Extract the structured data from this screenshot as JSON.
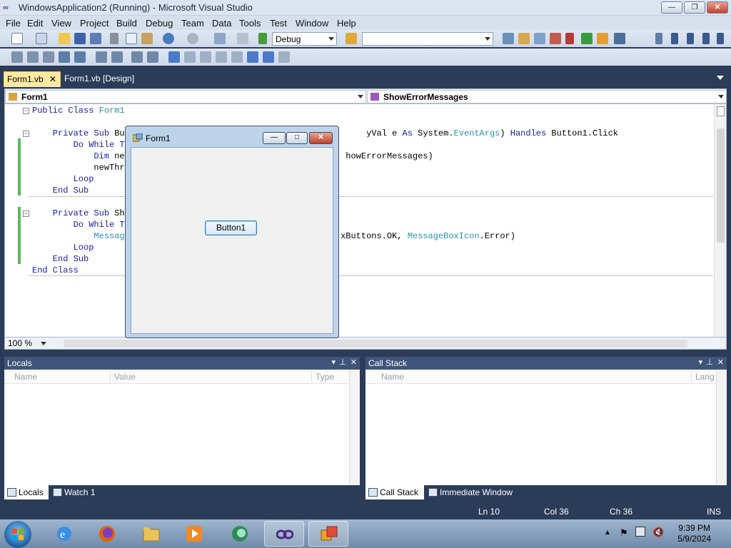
{
  "window": {
    "title": "WindowsApplication2 (Running) - Microsoft Visual Studio",
    "logo": "∞",
    "controls": [
      "minimize-icon",
      "restore-icon",
      "close-icon"
    ]
  },
  "menu": [
    "File",
    "Edit",
    "View",
    "Project",
    "Build",
    "Debug",
    "Team",
    "Data",
    "Tools",
    "Test",
    "Window",
    "Help"
  ],
  "toolbar": {
    "config_value": "Debug",
    "platform_value": ""
  },
  "doc_tabs": [
    {
      "label": "Form1.vb",
      "active": true
    },
    {
      "label": "Form1.vb [Design]",
      "active": false
    }
  ],
  "nav": {
    "class_combo": "Form1",
    "member_combo": "ShowErrorMessages"
  },
  "code": {
    "lines": [
      {
        "segs": [
          [
            "kw",
            "Public Class "
          ],
          [
            "ty",
            "Form1"
          ]
        ]
      },
      {
        "segs": []
      },
      {
        "segs": [
          [
            "kw",
            "    Private Sub "
          ],
          [
            "",
            "But"
          ],
          [
            "",
            "                                              "
          ],
          [
            "",
            "yVal "
          ],
          [
            "",
            "e "
          ],
          [
            "kw",
            "As "
          ],
          [
            "",
            "System."
          ],
          [
            "ty",
            "EventArgs"
          ],
          [
            "",
            ") "
          ],
          [
            "kw",
            "Handles "
          ],
          [
            "",
            "Button1.Click"
          ]
        ]
      },
      {
        "segs": [
          [
            "kw",
            "        Do While "
          ],
          [
            "kw",
            "Tr"
          ]
        ]
      },
      {
        "segs": [
          [
            "kw",
            "            Dim "
          ],
          [
            "",
            "new"
          ],
          [
            "",
            "                                          howErrorMessages)"
          ]
        ]
      },
      {
        "segs": [
          [
            "",
            "            newThre"
          ]
        ]
      },
      {
        "segs": [
          [
            "kw",
            "        Loop"
          ]
        ]
      },
      {
        "segs": [
          [
            "kw",
            "    End Sub"
          ]
        ]
      },
      {
        "segs": []
      },
      {
        "segs": [
          [
            "kw",
            "    Private Sub "
          ],
          [
            "",
            "Sho"
          ]
        ]
      },
      {
        "segs": [
          [
            "kw",
            "        Do While "
          ],
          [
            "kw",
            "Tr"
          ]
        ]
      },
      {
        "segs": [
          [
            "ty",
            "            Message"
          ],
          [
            "",
            "                                         xButtons.OK, "
          ],
          [
            "ty",
            "MessageBoxIcon"
          ],
          [
            "",
            ".Error)"
          ]
        ]
      },
      {
        "segs": [
          [
            "kw",
            "        Loop"
          ]
        ]
      },
      {
        "segs": [
          [
            "kw",
            "    End Sub"
          ]
        ]
      },
      {
        "segs": [
          [
            "kw",
            "End Class"
          ]
        ]
      }
    ]
  },
  "zoom_level": "100 %",
  "form1": {
    "title": "Form1",
    "button_label": "Button1"
  },
  "locals": {
    "title": "Locals",
    "columns": [
      "Name",
      "Value",
      "Type"
    ],
    "tabs": [
      {
        "label": "Locals",
        "active": true
      },
      {
        "label": "Watch 1",
        "active": false
      }
    ]
  },
  "callstack": {
    "title": "Call Stack",
    "columns": [
      "Name",
      "Lang"
    ],
    "tabs": [
      {
        "label": "Call Stack",
        "active": true
      },
      {
        "label": "Immediate Window",
        "active": false
      }
    ]
  },
  "status": {
    "ln": "Ln 10",
    "col": "Col 36",
    "ch": "Ch 36",
    "mode": "INS"
  },
  "taskbar": {
    "apps": [
      "internet-explorer-icon",
      "firefox-icon",
      "file-explorer-icon",
      "media-player-icon",
      "app-icon",
      "visual-studio-icon",
      "windows-form-icon"
    ],
    "time": "9:39 PM",
    "date": "5/9/2024"
  },
  "colors": {
    "keyword": "#1a1aa6",
    "type": "#2b91af",
    "ide_dark": "#2b3c59",
    "tab_active": "#fbe9a3",
    "toolwin_header": "#3f5478"
  }
}
